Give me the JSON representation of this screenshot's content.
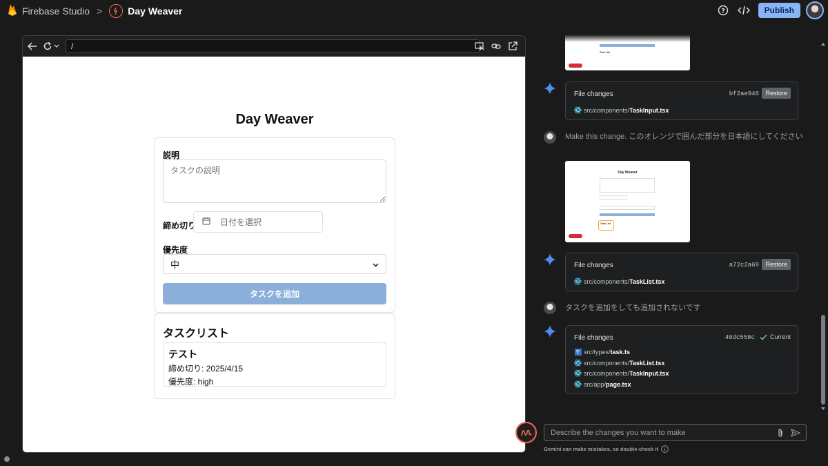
{
  "topbar": {
    "app_name": "Firebase Studio",
    "separator": ">",
    "project_name": "Day Weaver",
    "publish_label": "Publish",
    "icons": [
      "firebase-logo-icon",
      "project-logo-icon",
      "help-icon",
      "code-icon",
      "avatar"
    ]
  },
  "browser": {
    "url": "/",
    "icons": [
      "back-arrow-icon",
      "reload-icon",
      "chevron-down-icon",
      "inspect-icon",
      "link-icon",
      "open-external-icon"
    ]
  },
  "app_page": {
    "title": "Day Weaver",
    "form": {
      "description_label": "説明",
      "description_placeholder": "タスクの説明",
      "deadline_label": "締め切り",
      "date_placeholder": "日付を選択",
      "priority_label": "優先度",
      "priority_value": "中",
      "add_button": "タスクを追加"
    },
    "task_list": {
      "title": "タスクリスト",
      "tasks": [
        {
          "name": "テスト",
          "deadline": "締め切り: 2025/4/15",
          "priority": "優先度: high"
        }
      ]
    }
  },
  "chat": {
    "messages": [
      {
        "type": "file_changes",
        "title": "File changes",
        "hash": "bf2ae946",
        "action": "Restore",
        "files": [
          {
            "dir": "src/components/",
            "name": "TaskInput.tsx",
            "icon": "react-icon"
          }
        ]
      },
      {
        "type": "user",
        "text": "Make this change. このオレンジで囲んだ部分を日本語にしてください"
      },
      {
        "type": "file_changes",
        "title": "File changes",
        "hash": "a72c2a69",
        "action": "Restore",
        "files": [
          {
            "dir": "src/components/",
            "name": "TaskList.tsx",
            "icon": "react-icon"
          }
        ]
      },
      {
        "type": "user",
        "text": "タスクを追加をしても追加されないです"
      },
      {
        "type": "file_changes",
        "title": "File changes",
        "hash": "40dc558c",
        "action": "Current",
        "files": [
          {
            "dir": "src/types/",
            "name": "task.ts",
            "icon": "typescript-icon"
          },
          {
            "dir": "src/components/",
            "name": "TaskList.tsx",
            "icon": "react-icon"
          },
          {
            "dir": "src/components/",
            "name": "TaskInput.tsx",
            "icon": "react-icon"
          },
          {
            "dir": "src/app/",
            "name": "page.tsx",
            "icon": "react-icon"
          }
        ]
      }
    ],
    "thumbnail_top": {
      "task_list_label": "Task List"
    },
    "thumbnail_mid": {
      "title": "Day Weaver",
      "task_list_label": "Task List"
    }
  },
  "composer": {
    "placeholder": "Describe the changes you want to make",
    "disclaimer": "Gemini can make mistakes, so double-check it"
  },
  "colors": {
    "accent_blue": "#8ab4f8",
    "brand_orange": "#f26a4b",
    "button_disabled_blue": "#8bafd8",
    "background": "#1a1a1b"
  }
}
